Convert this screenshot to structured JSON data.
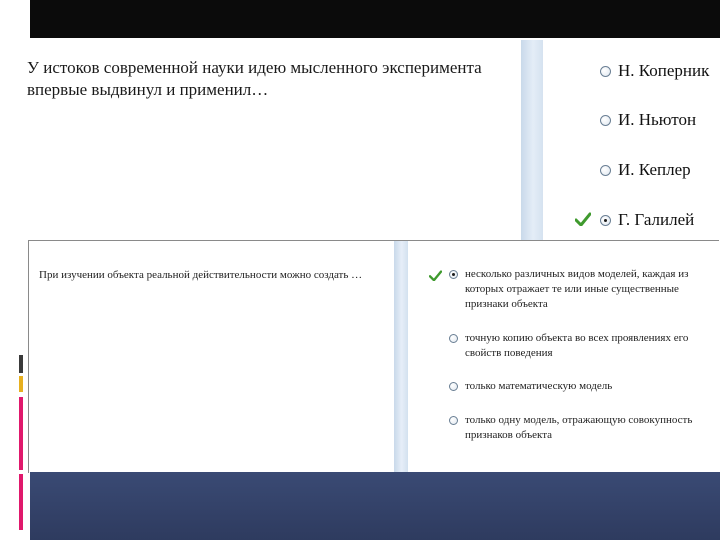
{
  "question1": {
    "text": "У истоков современной науки идею мысленного эксперимента впервые выдвинул и применил…",
    "options": [
      {
        "label": "Н. Коперник",
        "selected": false,
        "correct_mark": false
      },
      {
        "label": "И. Ньютон",
        "selected": false,
        "correct_mark": false
      },
      {
        "label": "И. Кеплер",
        "selected": false,
        "correct_mark": false
      },
      {
        "label": "Г. Галилей",
        "selected": true,
        "correct_mark": true
      }
    ]
  },
  "question2": {
    "text": "При изучении объекта реальной действительности можно создать …",
    "options": [
      {
        "label": "несколько различных видов моделей, каждая из которых отражает те или иные существенные признаки объекта",
        "selected": true,
        "correct_mark": true
      },
      {
        "label": "точную копию объекта во всех проявлениях его свойств поведения",
        "selected": false,
        "correct_mark": false
      },
      {
        "label": "только математическую модель",
        "selected": false,
        "correct_mark": false
      },
      {
        "label": "только одну модель, отражающую совокупность признаков объекта",
        "selected": false,
        "correct_mark": false
      }
    ]
  },
  "colors": {
    "check": "#3f9a2e",
    "divider": "#dbe6f2",
    "bottom_band": "#34436a",
    "accent_pink": "#e0186c",
    "accent_gold": "#e7b01f"
  },
  "icons": {
    "correct": "check-icon",
    "choice": "radio-icon"
  }
}
